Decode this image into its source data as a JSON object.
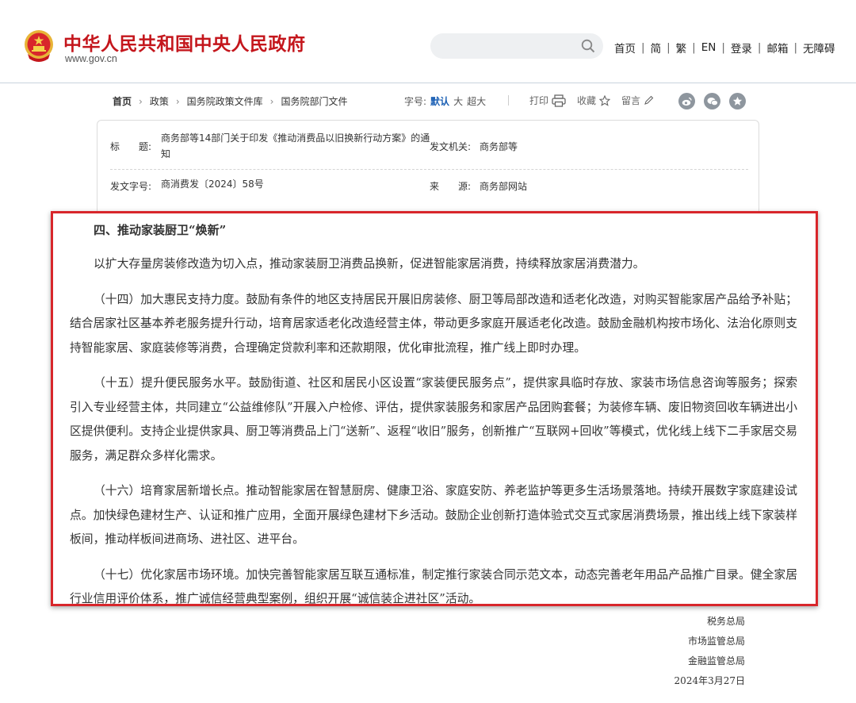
{
  "header": {
    "site_name": "中华人民共和国中央人民政府",
    "site_url": "www.gov.cn",
    "search_placeholder": "",
    "nav": [
      "首页",
      "简",
      "繁",
      "EN",
      "登录",
      "邮箱",
      "无障碍"
    ]
  },
  "breadcrumb": [
    "首页",
    "政策",
    "国务院政策文件库",
    "国务院部门文件"
  ],
  "font_size": {
    "label": "字号:",
    "options": [
      "默认",
      "大",
      "超大"
    ],
    "selected": "默认"
  },
  "tools": {
    "print": "打印",
    "favorite": "收藏",
    "comment": "留言"
  },
  "social_icons": [
    "weibo-icon",
    "wechat-icon",
    "star-icon"
  ],
  "info": {
    "title_label": "标　　题:",
    "title": "商务部等14部门关于印发《推动消费品以旧换新行动方案》的通知",
    "issuer_label": "发文机关:",
    "issuer": "商务部等",
    "doc_no_label": "发文字号:",
    "doc_no": "商消费发〔2024〕58号",
    "source_label": "来　　源:",
    "source": "商务部网站"
  },
  "article": {
    "heading": "四、推动家装厨卫“焕新”",
    "paragraphs": [
      "以扩大存量房装修改造为切入点，推动家装厨卫消费品换新，促进智能家居消费，持续释放家居消费潜力。",
      "（十四）加大惠民支持力度。鼓励有条件的地区支持居民开展旧房装修、厨卫等局部改造和适老化改造，对购买智能家居产品给予补贴；结合居家社区基本养老服务提升行动，培育居家适老化改造经营主体，带动更多家庭开展适老化改造。鼓励金融机构按市场化、法治化原则支持智能家居、家庭装修等消费，合理确定贷款利率和还款期限，优化审批流程，推广线上即时办理。",
      "（十五）提升便民服务水平。鼓励街道、社区和居民小区设置“家装便民服务点”，提供家具临时存放、家装市场信息咨询等服务；探索引入专业经营主体，共同建立“公益维修队”开展入户检修、评估，提供家装服务和家居产品团购套餐；为装修车辆、废旧物资回收车辆进出小区提供便利。支持企业提供家具、厨卫等消费品上门“送新”、返程“收旧”服务，创新推广“互联网+回收”等模式，优化线上线下二手家居交易服务，满足群众多样化需求。",
      "（十六）培育家居新增长点。推动智能家居在智慧厨房、健康卫浴、家庭安防、养老监护等更多生活场景落地。持续开展数字家庭建设试点。加快绿色建材生产、认证和推广应用，全面开展绿色建材下乡活动。鼓励企业创新打造体验式交互式家居消费场景，推出线上线下家装样板间，推动样板间进商场、进社区、进平台。",
      "（十七）优化家居市场环境。加快完善智能家居互联互通标准，制定推行家装合同示范文本，动态完善老年用品产品推广目录。健全家居行业信用评价体系，推广诚信经营典型案例，组织开展“诚信装企进社区”活动。"
    ]
  },
  "signatures": [
    "税务总局",
    "市场监管总局",
    "金融监管总局",
    "2024年3月27日"
  ],
  "colors": {
    "brand_red": "#c4161c",
    "highlight_border": "#d8262b",
    "link_blue": "#1a5fb4"
  }
}
